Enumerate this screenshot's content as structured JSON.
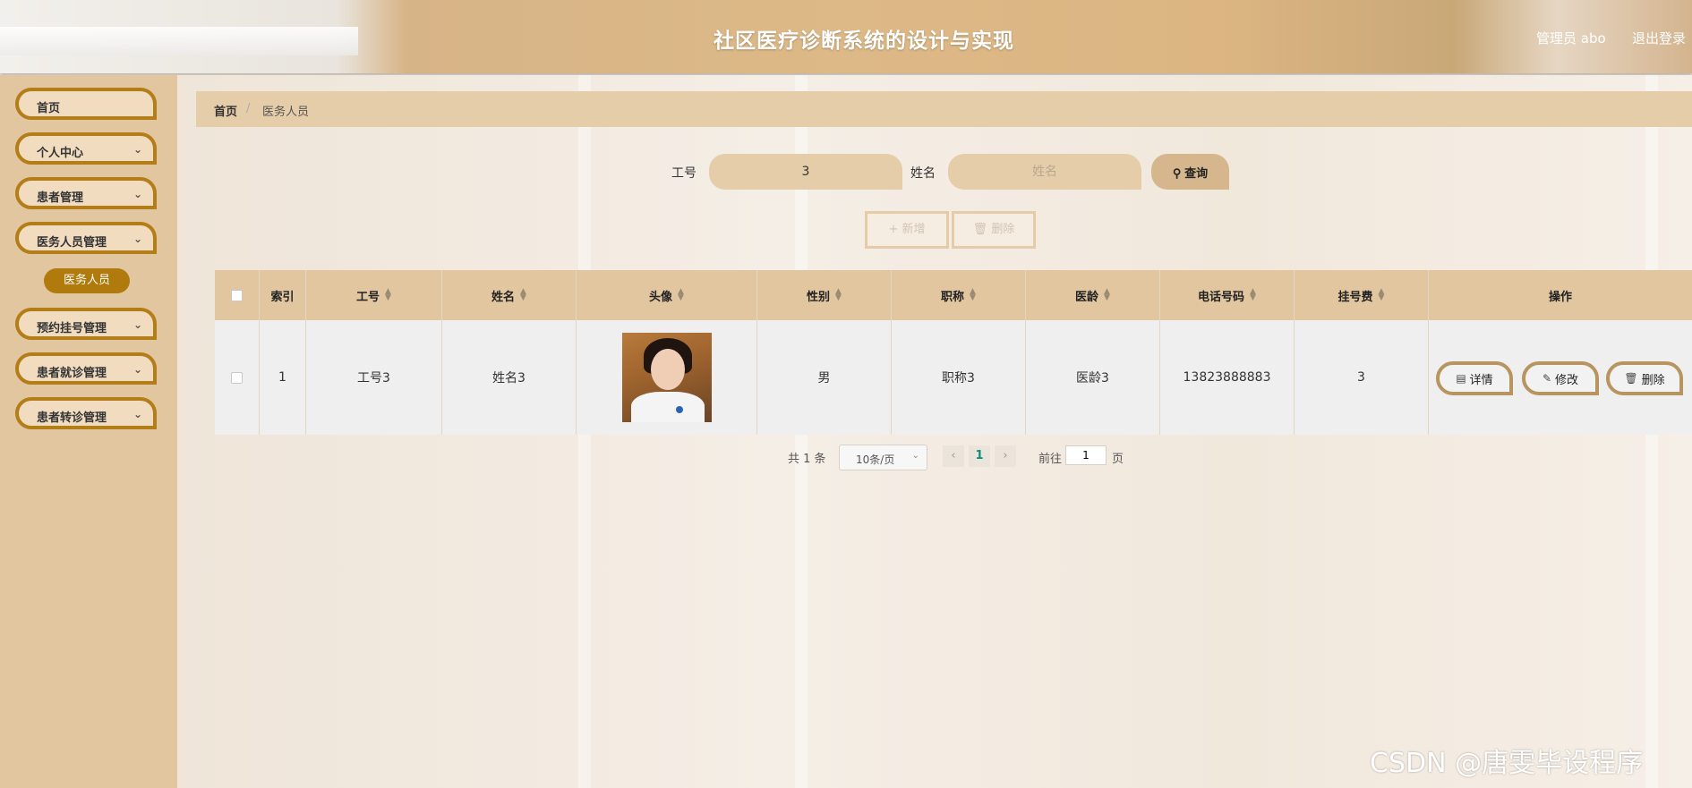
{
  "header": {
    "title": "社区医疗诊断系统的设计与实现",
    "user_label": "管理员 abo",
    "logout_label": "退出登录"
  },
  "sidebar": {
    "items": [
      {
        "label": "首页",
        "has_children": false
      },
      {
        "label": "个人中心",
        "has_children": true
      },
      {
        "label": "患者管理",
        "has_children": true
      },
      {
        "label": "医务人员管理",
        "has_children": true
      },
      {
        "label": "预约挂号管理",
        "has_children": true
      },
      {
        "label": "患者就诊管理",
        "has_children": true
      },
      {
        "label": "患者转诊管理",
        "has_children": true
      }
    ],
    "active_sub_item": "医务人员"
  },
  "breadcrumb": {
    "home": "首页",
    "separator": "/",
    "current": "医务人员"
  },
  "search": {
    "job_no_label": "工号",
    "job_no_value": "3",
    "name_label": "姓名",
    "name_placeholder": "姓名",
    "query_label": "查询"
  },
  "actions": {
    "add_label": "新增",
    "delete_label": "删除"
  },
  "table": {
    "columns": [
      "索引",
      "工号",
      "姓名",
      "头像",
      "性别",
      "职称",
      "医龄",
      "电话号码",
      "挂号费",
      "操作"
    ],
    "rows": [
      {
        "index": "1",
        "job_no": "工号3",
        "name": "姓名3",
        "gender": "男",
        "title": "职称3",
        "seniority": "医龄3",
        "phone": "13823888883",
        "fee": "3"
      }
    ],
    "row_actions": {
      "detail": "详情",
      "edit": "修改",
      "delete": "删除"
    }
  },
  "pagination": {
    "total_text": "共 1 条",
    "page_size": "10条/页",
    "current_page": "1",
    "goto_label": "前往",
    "goto_value": "1",
    "page_suffix": "页"
  },
  "watermark": "CSDN @唐雯毕设程序",
  "colors": {
    "accent": "#b37d17",
    "header": "#ddb987",
    "sidebar": "#e1c6a0"
  }
}
